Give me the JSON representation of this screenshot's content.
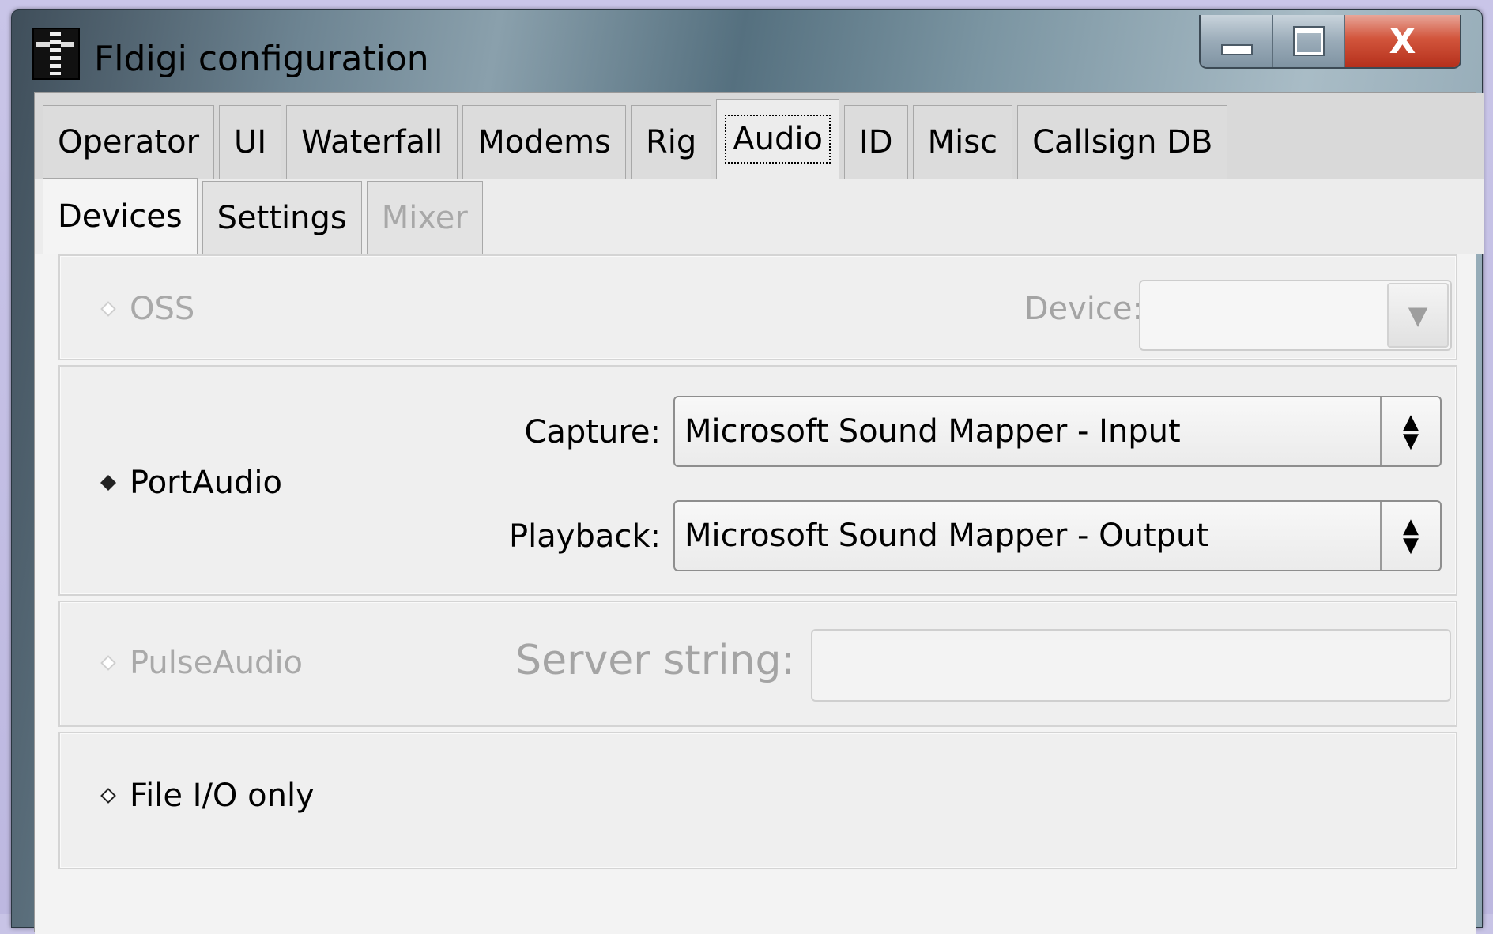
{
  "window": {
    "title": "Fldigi configuration",
    "caption_buttons": {
      "minimize_icon": "minimize-icon",
      "maximize_icon": "maximize-icon",
      "close_label": "X"
    }
  },
  "tabs": [
    {
      "label": "Operator"
    },
    {
      "label": "UI"
    },
    {
      "label": "Waterfall"
    },
    {
      "label": "Modems"
    },
    {
      "label": "Rig"
    },
    {
      "label": "Audio",
      "active": true
    },
    {
      "label": "ID"
    },
    {
      "label": "Misc"
    },
    {
      "label": "Callsign DB"
    }
  ],
  "subtabs": [
    {
      "label": "Devices",
      "active": true
    },
    {
      "label": "Settings"
    },
    {
      "label": "Mixer",
      "disabled": true
    }
  ],
  "oss": {
    "label": "OSS",
    "device_label": "Device:",
    "device_value": ""
  },
  "portaudio": {
    "label": "PortAudio",
    "capture_label": "Capture:",
    "capture_value": "Microsoft Sound Mapper - Input",
    "playback_label": "Playback:",
    "playback_value": "Microsoft Sound Mapper - Output"
  },
  "pulseaudio": {
    "label": "PulseAudio",
    "server_label": "Server string:",
    "server_value": ""
  },
  "fileio": {
    "label": "File I/O only"
  }
}
